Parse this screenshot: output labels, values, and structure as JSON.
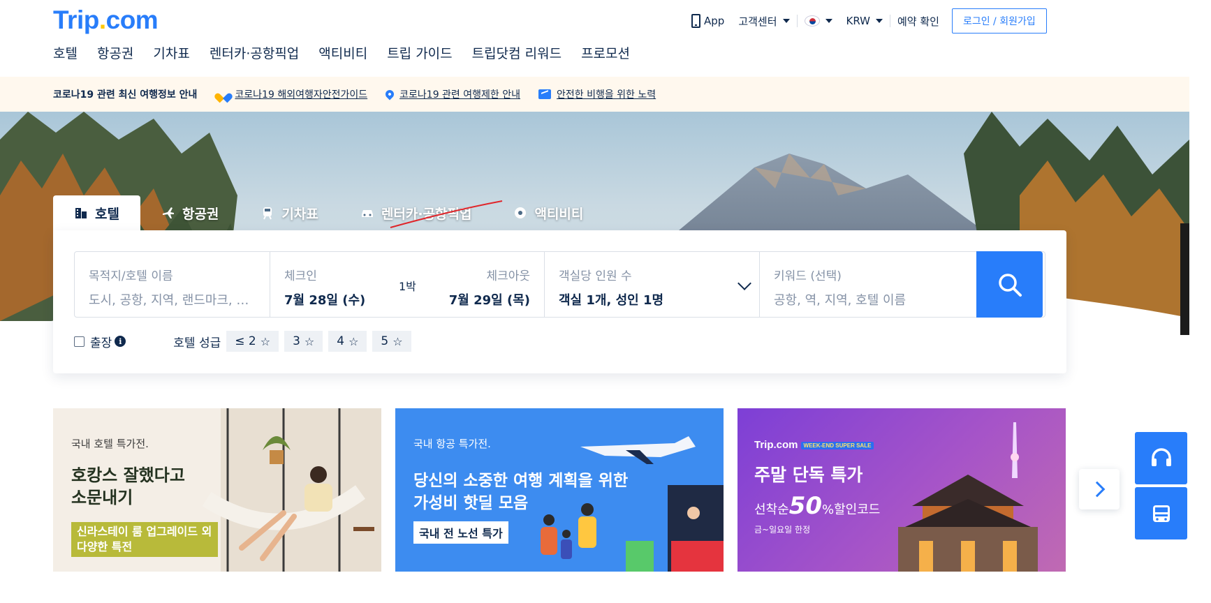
{
  "brand": {
    "name": "Trip",
    "dot": ".",
    "tld": "com"
  },
  "header": {
    "app_label": "App",
    "support_label": "고객센터",
    "currency_label": "KRW",
    "booking_check_label": "예약 확인",
    "login_label": "로그인 / 회원가입"
  },
  "nav": {
    "items": [
      {
        "label": "호텔"
      },
      {
        "label": "항공권"
      },
      {
        "label": "기차표"
      },
      {
        "label": "렌터카·공항픽업"
      },
      {
        "label": "액티비티"
      },
      {
        "label": "트립 가이드"
      },
      {
        "label": "트립닷컴 리워드"
      },
      {
        "label": "프로모션"
      }
    ]
  },
  "notice": {
    "title": "코로나19 관련 최신 여행정보 안내",
    "links": [
      {
        "label": "코로나19 해외여행자안전가이드",
        "icon": "heart-icon"
      },
      {
        "label": "코로나19 관련 여행제한 안내",
        "icon": "location-pin-icon"
      },
      {
        "label": "안전한 비행을 위한 노력",
        "icon": "plane-box-icon"
      }
    ]
  },
  "search": {
    "tabs": [
      {
        "label": "호텔",
        "icon": "hotel-icon",
        "active": true
      },
      {
        "label": "항공권",
        "icon": "plane-icon",
        "active": false
      },
      {
        "label": "기차표",
        "icon": "train-icon",
        "active": false
      },
      {
        "label": "렌터카·공항픽업",
        "icon": "car-icon",
        "active": false
      },
      {
        "label": "액티비티",
        "icon": "activity-icon",
        "active": false
      }
    ],
    "destination": {
      "label": "목적지/호텔 이름",
      "placeholder": "도시, 공항, 지역, 랜드마크, 호텔 이름"
    },
    "checkin": {
      "label": "체크인",
      "value": "7월 28일 (수)"
    },
    "nights": "1박",
    "checkout": {
      "label": "체크아웃",
      "value": "7월 29일 (목)"
    },
    "guests": {
      "label": "객실당 인원 수",
      "value": "객실 1개, 성인 1명"
    },
    "keyword": {
      "label": "키워드 (선택)",
      "placeholder": "공항, 역, 지역, 호텔 이름"
    },
    "business_trip_label": "출장",
    "star_rating_label": "호텔 성급",
    "star_options": [
      "≤ 2",
      "3",
      "4",
      "5"
    ]
  },
  "banners": [
    {
      "category": "국내 호텔 특가전.",
      "headline_1": "호캉스 잘했다고",
      "headline_2": "소문내기",
      "tag": "신라스테이 룸 업그레이드 외 다양한 특전"
    },
    {
      "category": "국내 항공 특가전.",
      "headline_1": "당신의 소중한 여행 계획을 위한",
      "headline_2": "가성비 핫딜 모음",
      "tag": "국내 전 노선 특가"
    },
    {
      "brand": "Trip.com",
      "badge": "WEEK-END SUPER SALE",
      "headline": "주말 단독 특가",
      "sub_prefix": "선착순",
      "sub_big": "50",
      "sub_suffix": "%할인코드",
      "small": "금~일요일 한정"
    }
  ],
  "colors": {
    "primary": "#287dfa",
    "text": "#0f294d",
    "notice_bg": "#fff8ee",
    "logo_dot": "#ffc800"
  }
}
